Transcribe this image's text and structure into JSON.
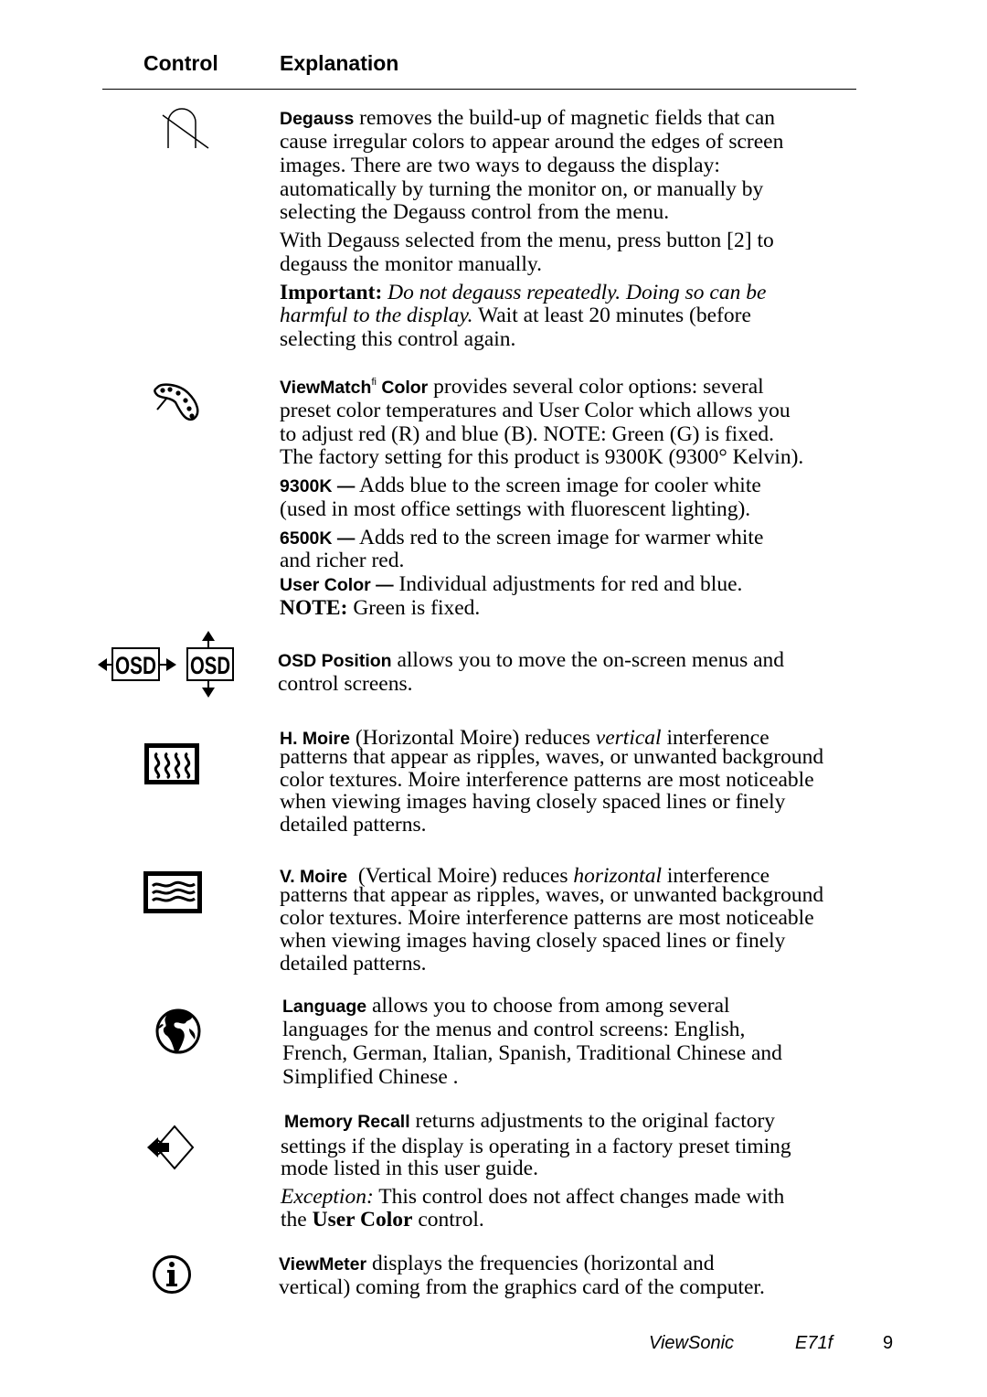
{
  "header": {
    "control": "Control",
    "explanation": "Explanation"
  },
  "rows": {
    "degauss": {
      "icon": "degauss-icon",
      "term": "Degauss",
      "l1": " removes the build-up of magnetic fields that can",
      "l2": "cause irregular colors to appear around the edges of screen",
      "l3": "images. There are two ways to degauss the display:",
      "l4": "automatically by turning the monitor on, or manually by",
      "l5": "selecting the Degauss control from the menu.",
      "p2l1": "With Degauss selected from the menu, press button [2] to",
      "p2l2": "degauss the monitor manually.",
      "important_label": "Important:",
      "important_italic1": " Do not degauss repeatedly. Doing so can be",
      "important_italic2": "harmful to the display.",
      "important_rest2": " Wait at least 20 minutes (before",
      "important_l3": "selecting this control again."
    },
    "viewmatch": {
      "icon": "palette-icon",
      "term": "ViewMatch",
      "sup": "fi",
      "term2": " Color",
      "l1": " provides several color options: several",
      "l2": "preset color temperatures and User Color which allows you",
      "l3": "to adjust  red (R) and blue (B). NOTE: Green (G) is fixed.",
      "l4": "The factory setting for this product is 9300K (9300° Kelvin).",
      "k9300_label": "9300K —",
      "k9300_l1": " Adds blue to the screen image for cooler white",
      "k9300_l2": "(used in most office settings with fluorescent lighting).",
      "k6500_label": "6500K —",
      "k6500_l1": " Adds red to the screen image for warmer white",
      "k6500_l2": "and richer red.",
      "user_label": "User Color —",
      "user_l1": " Individual adjustments for red and blue.",
      "note_label": "NOTE:",
      "note_text": " Green is fixed."
    },
    "osd": {
      "icon_h": "osd-horizontal-position-icon",
      "icon_v": "osd-vertical-position-icon",
      "icon_text": "OSD",
      "term": "OSD Position",
      "l1": " allows you to move the on-screen menus and",
      "l2": "control screens."
    },
    "hmoire": {
      "icon": "h-moire-icon",
      "term": "H. Moire",
      "l1a": " (Horizontal Moire) reduces ",
      "l1i": "vertical",
      "l1b": " interference",
      "l2": "patterns that appear as ripples, waves, or unwanted background",
      "l3": "color textures. Moire interference patterns are most noticeable",
      "l4": "when viewing images having closely spaced lines or finely",
      "l5": "detailed patterns."
    },
    "vmoire": {
      "icon": "v-moire-icon",
      "term": "V. Moire",
      "l1a": "  (Vertical Moire) reduces ",
      "l1i": "horizontal",
      "l1b": " interference",
      "l2": "patterns that appear as ripples, waves, or unwanted background",
      "l3": "color textures. Moire interference patterns are most noticeable",
      "l4": "when viewing images having closely spaced lines or finely",
      "l5": "detailed patterns."
    },
    "language": {
      "icon": "globe-icon",
      "term": "Language",
      "l1": " allows you to choose from among several",
      "l2": "languages for the menus and control screens: English,",
      "l3": "French, German, Italian, Spanish, Traditional Chinese and",
      "l4": "Simplified Chinese ."
    },
    "memory": {
      "icon": "memory-recall-icon",
      "term": "Memory Recall",
      "l1": " returns adjustments to the original factory",
      "l2": "settings if the display is operating in a factory preset timing",
      "l3": "mode listed in this user guide.",
      "exc_label": "Exception:",
      "exc_l1": " This control does not affect changes made with",
      "exc_l2a": "the ",
      "exc_l2b": "User Color",
      "exc_l2c": " control."
    },
    "viewmeter": {
      "icon": "info-icon",
      "term": "ViewMeter",
      "l1": " displays the frequencies (horizontal and",
      "l2": "vertical) coming from the graphics card of the computer."
    }
  },
  "footer": {
    "brand": "ViewSonic",
    "model": "E71f",
    "page": "9"
  }
}
